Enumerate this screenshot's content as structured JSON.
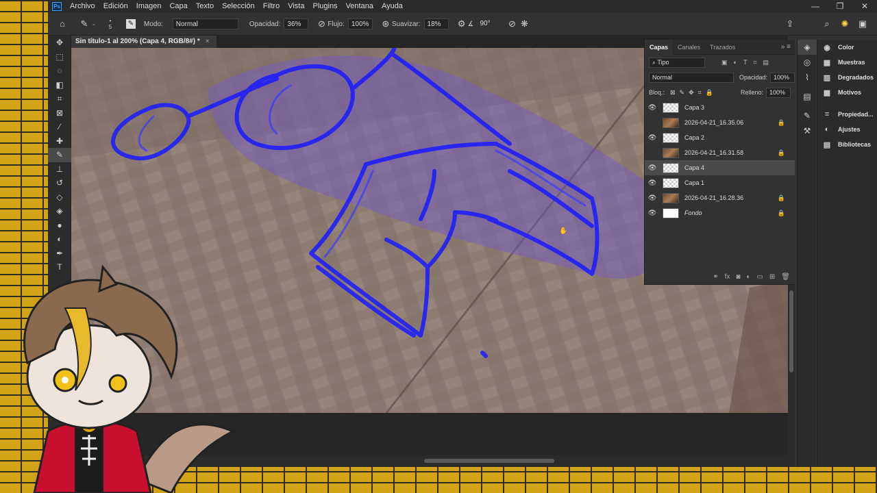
{
  "menubar": {
    "logo": "Ps",
    "items": [
      "Archivo",
      "Edición",
      "Imagen",
      "Capa",
      "Texto",
      "Selección",
      "Filtro",
      "Vista",
      "Plugins",
      "Ventana",
      "Ayuda"
    ]
  },
  "options": {
    "brush_size": "5",
    "mode_label": "Modo:",
    "mode_value": "Normal",
    "opacity_label": "Opacidad:",
    "opacity_value": "36%",
    "flow_label": "Flujo:",
    "flow_value": "100%",
    "smoothing_label": "Suavizar:",
    "smoothing_value": "18%",
    "angle_value": "90°"
  },
  "document": {
    "tab_title": "Sin título-1 al 200% (Capa 4, RGB/8#) *"
  },
  "layers_panel": {
    "tabs": [
      "Capas",
      "Canales",
      "Trazados"
    ],
    "filter_value": "Tipo",
    "blend_mode": "Normal",
    "opacity_label": "Opacidad:",
    "opacity_value": "100%",
    "lock_label": "Bloq.:",
    "fill_label": "Relleno:",
    "fill_value": "100%",
    "layers": [
      {
        "name": "Capa 3",
        "visible": true,
        "thumb": "checker",
        "locked": false,
        "selected": false
      },
      {
        "name": "2026-04-21_16.35.06",
        "visible": false,
        "thumb": "photo",
        "locked": true,
        "selected": false
      },
      {
        "name": "Capa 2",
        "visible": true,
        "thumb": "checker",
        "locked": false,
        "selected": false
      },
      {
        "name": "2026-04-21_16.31.58",
        "visible": false,
        "thumb": "photo",
        "locked": true,
        "selected": false
      },
      {
        "name": "Capa 4",
        "visible": true,
        "thumb": "checker",
        "locked": false,
        "selected": true
      },
      {
        "name": "Capa 1",
        "visible": true,
        "thumb": "checker",
        "locked": false,
        "selected": false
      },
      {
        "name": "2026-04-21_16.28.36",
        "visible": true,
        "thumb": "photo",
        "locked": true,
        "selected": false
      },
      {
        "name": "Fondo",
        "visible": true,
        "thumb": "white",
        "locked": true,
        "selected": false
      }
    ]
  },
  "right_panel": {
    "items": [
      "Color",
      "Muestras",
      "Degradados",
      "Motivos",
      "Propiedad...",
      "Ajustes",
      "Bibliotecas"
    ]
  },
  "colors": {
    "stroke": "#1a1aff",
    "accent": "#31a8ff",
    "brick": "#d4a418"
  }
}
